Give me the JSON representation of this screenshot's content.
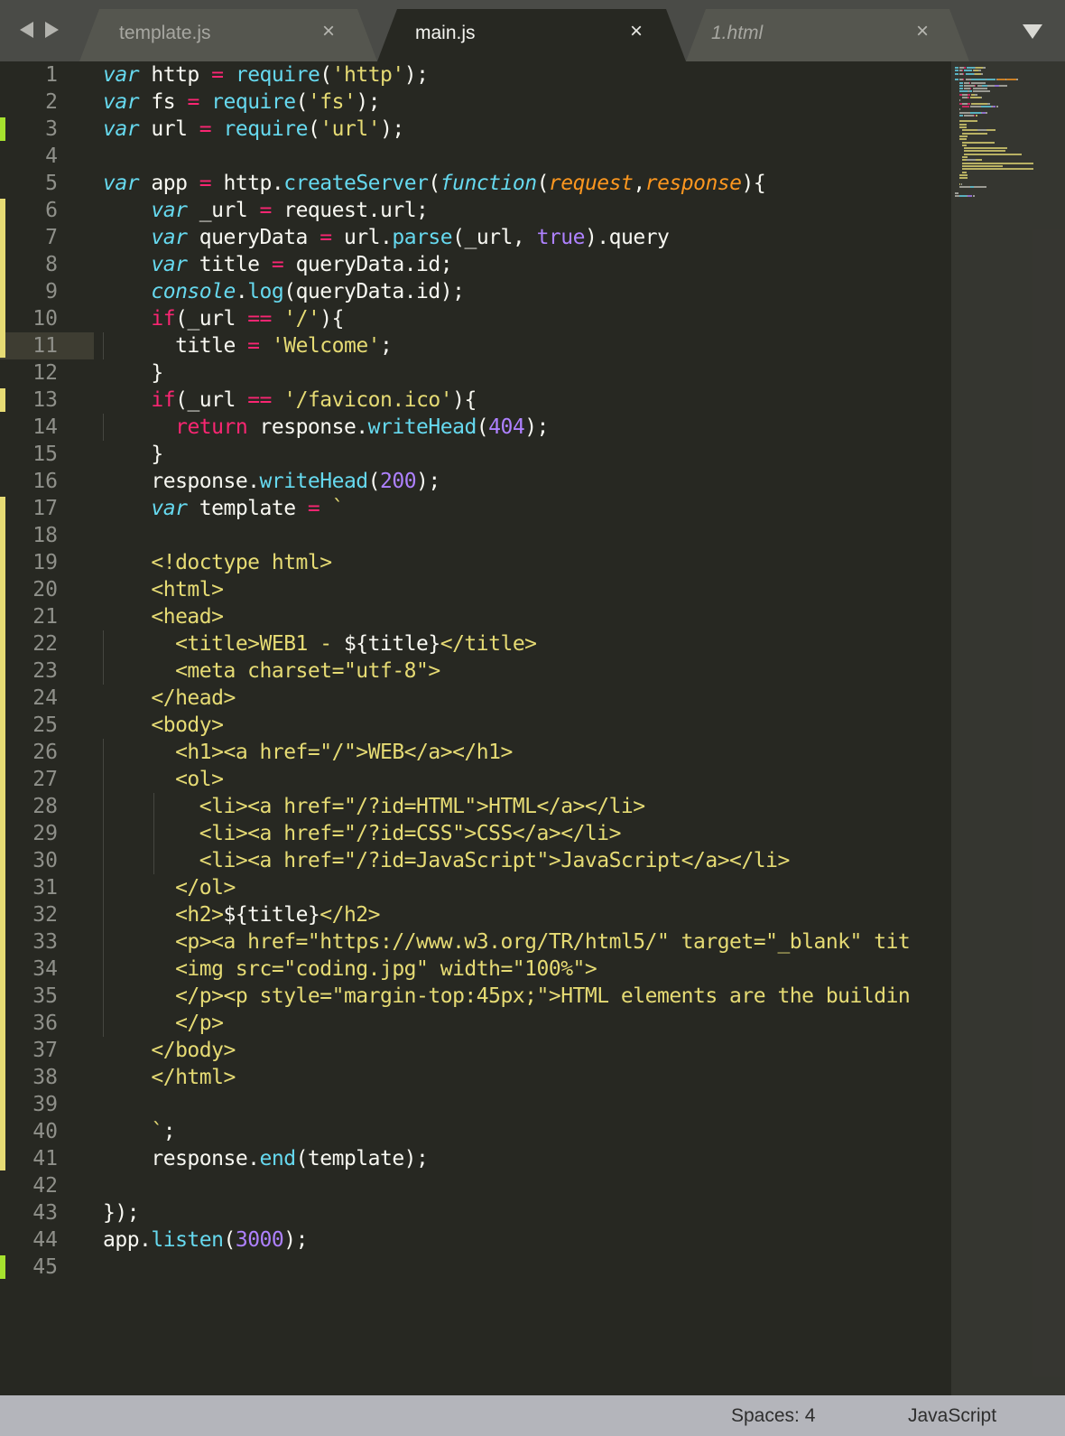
{
  "tabs": [
    {
      "label": "template.js",
      "active": false
    },
    {
      "label": "main.js",
      "active": true
    },
    {
      "label": "1.html",
      "active": false
    }
  ],
  "icons": {
    "back": "left-arrow",
    "forward": "right-arrow",
    "close": "×",
    "dropdown": "triangle-down"
  },
  "editor": {
    "highlighted_line": 11,
    "lines": [
      {
        "n": "1",
        "t": [
          [
            "kw",
            "var"
          ],
          [
            "tx",
            " http "
          ],
          [
            "op",
            "="
          ],
          [
            "tx",
            " "
          ],
          [
            "fn",
            "require"
          ],
          [
            "tx",
            "("
          ],
          [
            "st",
            "'http'"
          ],
          [
            "tx",
            ");"
          ]
        ]
      },
      {
        "n": "2",
        "t": [
          [
            "kw",
            "var"
          ],
          [
            "tx",
            " fs "
          ],
          [
            "op",
            "="
          ],
          [
            "tx",
            " "
          ],
          [
            "fn",
            "require"
          ],
          [
            "tx",
            "("
          ],
          [
            "st",
            "'fs'"
          ],
          [
            "tx",
            ");"
          ]
        ]
      },
      {
        "n": "3",
        "t": [
          [
            "kw",
            "var"
          ],
          [
            "tx",
            " url "
          ],
          [
            "op",
            "="
          ],
          [
            "tx",
            " "
          ],
          [
            "fn",
            "require"
          ],
          [
            "tx",
            "("
          ],
          [
            "st",
            "'url'"
          ],
          [
            "tx",
            ");"
          ]
        ]
      },
      {
        "n": "4",
        "t": []
      },
      {
        "n": "5",
        "t": [
          [
            "kw",
            "var"
          ],
          [
            "tx",
            " app "
          ],
          [
            "op",
            "="
          ],
          [
            "tx",
            " http."
          ],
          [
            "fn",
            "createServer"
          ],
          [
            "tx",
            "("
          ],
          [
            "kw",
            "function"
          ],
          [
            "tx",
            "("
          ],
          [
            "pa",
            "request"
          ],
          [
            "tx",
            ","
          ],
          [
            "pa",
            "response"
          ],
          [
            "tx",
            "){"
          ]
        ]
      },
      {
        "n": "6",
        "t": [
          [
            "tx",
            "    "
          ],
          [
            "kw",
            "var"
          ],
          [
            "tx",
            " _url "
          ],
          [
            "op",
            "="
          ],
          [
            "tx",
            " request.url;"
          ]
        ]
      },
      {
        "n": "7",
        "t": [
          [
            "tx",
            "    "
          ],
          [
            "kw",
            "var"
          ],
          [
            "tx",
            " queryData "
          ],
          [
            "op",
            "="
          ],
          [
            "tx",
            " url."
          ],
          [
            "fn",
            "parse"
          ],
          [
            "tx",
            "(_url, "
          ],
          [
            "nm",
            "true"
          ],
          [
            "tx",
            ").query"
          ]
        ]
      },
      {
        "n": "8",
        "t": [
          [
            "tx",
            "    "
          ],
          [
            "kw",
            "var"
          ],
          [
            "tx",
            " title "
          ],
          [
            "op",
            "="
          ],
          [
            "tx",
            " queryData.id;"
          ]
        ]
      },
      {
        "n": "9",
        "t": [
          [
            "tx",
            "    "
          ],
          [
            "kw",
            "console"
          ],
          [
            "tx",
            "."
          ],
          [
            "fn",
            "log"
          ],
          [
            "tx",
            "(queryData.id);"
          ]
        ]
      },
      {
        "n": "10",
        "t": [
          [
            "tx",
            "    "
          ],
          [
            "op",
            "if"
          ],
          [
            "tx",
            "(_url "
          ],
          [
            "op",
            "=="
          ],
          [
            "tx",
            " "
          ],
          [
            "st",
            "'/'"
          ],
          [
            "tx",
            "){"
          ]
        ]
      },
      {
        "n": "11",
        "t": [
          [
            "tx",
            "      title "
          ],
          [
            "op",
            "="
          ],
          [
            "tx",
            " "
          ],
          [
            "st",
            "'Welcome'"
          ],
          [
            "tx",
            ";"
          ]
        ]
      },
      {
        "n": "12",
        "t": [
          [
            "tx",
            "    }"
          ]
        ]
      },
      {
        "n": "13",
        "t": [
          [
            "tx",
            "    "
          ],
          [
            "op",
            "if"
          ],
          [
            "tx",
            "(_url "
          ],
          [
            "op",
            "=="
          ],
          [
            "tx",
            " "
          ],
          [
            "st",
            "'/favicon.ico'"
          ],
          [
            "tx",
            "){"
          ]
        ]
      },
      {
        "n": "14",
        "t": [
          [
            "tx",
            "      "
          ],
          [
            "op",
            "return"
          ],
          [
            "tx",
            " response."
          ],
          [
            "fn",
            "writeHead"
          ],
          [
            "tx",
            "("
          ],
          [
            "nm",
            "404"
          ],
          [
            "tx",
            ");"
          ]
        ]
      },
      {
        "n": "15",
        "t": [
          [
            "tx",
            "    }"
          ]
        ]
      },
      {
        "n": "16",
        "t": [
          [
            "tx",
            "    response."
          ],
          [
            "fn",
            "writeHead"
          ],
          [
            "tx",
            "("
          ],
          [
            "nm",
            "200"
          ],
          [
            "tx",
            ");"
          ]
        ]
      },
      {
        "n": "17",
        "t": [
          [
            "tx",
            "    "
          ],
          [
            "kw",
            "var"
          ],
          [
            "tx",
            " template "
          ],
          [
            "op",
            "="
          ],
          [
            "tx",
            " "
          ],
          [
            "st",
            "`"
          ]
        ]
      },
      {
        "n": "18",
        "t": []
      },
      {
        "n": "19",
        "t": [
          [
            "st",
            "    <!doctype html>"
          ]
        ]
      },
      {
        "n": "20",
        "t": [
          [
            "st",
            "    <html>"
          ]
        ]
      },
      {
        "n": "21",
        "t": [
          [
            "st",
            "    <head>"
          ]
        ]
      },
      {
        "n": "22",
        "t": [
          [
            "st",
            "      <title>WEB1 - "
          ],
          [
            "tx",
            "${title}"
          ],
          [
            "st",
            "</title>"
          ]
        ]
      },
      {
        "n": "23",
        "t": [
          [
            "st",
            "      <meta charset=\"utf-8\">"
          ]
        ]
      },
      {
        "n": "24",
        "t": [
          [
            "st",
            "    </head>"
          ]
        ]
      },
      {
        "n": "25",
        "t": [
          [
            "st",
            "    <body>"
          ]
        ]
      },
      {
        "n": "26",
        "t": [
          [
            "st",
            "      <h1><a href=\"/\">WEB</a></h1>"
          ]
        ]
      },
      {
        "n": "27",
        "t": [
          [
            "st",
            "      <ol>"
          ]
        ]
      },
      {
        "n": "28",
        "t": [
          [
            "st",
            "        <li><a href=\"/?id=HTML\">HTML</a></li>"
          ]
        ]
      },
      {
        "n": "29",
        "t": [
          [
            "st",
            "        <li><a href=\"/?id=CSS\">CSS</a></li>"
          ]
        ]
      },
      {
        "n": "30",
        "t": [
          [
            "st",
            "        <li><a href=\"/?id=JavaScript\">JavaScript</a></li>"
          ]
        ]
      },
      {
        "n": "31",
        "t": [
          [
            "st",
            "      </ol>"
          ]
        ]
      },
      {
        "n": "32",
        "t": [
          [
            "st",
            "      <h2>"
          ],
          [
            "tx",
            "${title}"
          ],
          [
            "st",
            "</h2>"
          ]
        ]
      },
      {
        "n": "33",
        "t": [
          [
            "st",
            "      <p><a href=\"https://www.w3.org/TR/html5/\" target=\"_blank\" tit"
          ]
        ]
      },
      {
        "n": "34",
        "t": [
          [
            "st",
            "      <img src=\"coding.jpg\" width=\"100%\">"
          ]
        ]
      },
      {
        "n": "35",
        "t": [
          [
            "st",
            "      </p><p style=\"margin-top:45px;\">HTML elements are the buildin"
          ]
        ]
      },
      {
        "n": "36",
        "t": [
          [
            "st",
            "      </p>"
          ]
        ]
      },
      {
        "n": "37",
        "t": [
          [
            "st",
            "    </body>"
          ]
        ]
      },
      {
        "n": "38",
        "t": [
          [
            "st",
            "    </html>"
          ]
        ]
      },
      {
        "n": "39",
        "t": []
      },
      {
        "n": "40",
        "t": [
          [
            "st",
            "    `"
          ],
          [
            "tx",
            ";"
          ]
        ]
      },
      {
        "n": "41",
        "t": [
          [
            "tx",
            "    response."
          ],
          [
            "fn",
            "end"
          ],
          [
            "tx",
            "(template);"
          ]
        ]
      },
      {
        "n": "42",
        "t": []
      },
      {
        "n": "43",
        "t": [
          [
            "tx",
            "});"
          ]
        ]
      },
      {
        "n": "44",
        "t": [
          [
            "tx",
            "app."
          ],
          [
            "fn",
            "listen"
          ],
          [
            "tx",
            "("
          ],
          [
            "nm",
            "3000"
          ],
          [
            "tx",
            ");"
          ]
        ]
      },
      {
        "n": "45",
        "t": []
      }
    ],
    "gutter_marks": [
      {
        "from": 3,
        "to": 3,
        "color": "#a6e22e"
      },
      {
        "from": 6,
        "to": 11,
        "color": "#e6db74"
      },
      {
        "from": 13,
        "to": 13,
        "color": "#e6db74"
      },
      {
        "from": 17,
        "to": 41,
        "color": "#e6db74"
      },
      {
        "from": 45,
        "to": 45,
        "color": "#a6e22e"
      }
    ]
  },
  "status": {
    "spaces": "Spaces: 4",
    "syntax": "JavaScript"
  },
  "colors": {
    "background": "#272822",
    "tabbar": "#4a4b47",
    "statusbar": "#b4b5bb",
    "keyword": "#66d9ef",
    "operator": "#f92672",
    "string": "#e6db74",
    "number": "#ae81ff",
    "parameter": "#fd971f"
  }
}
